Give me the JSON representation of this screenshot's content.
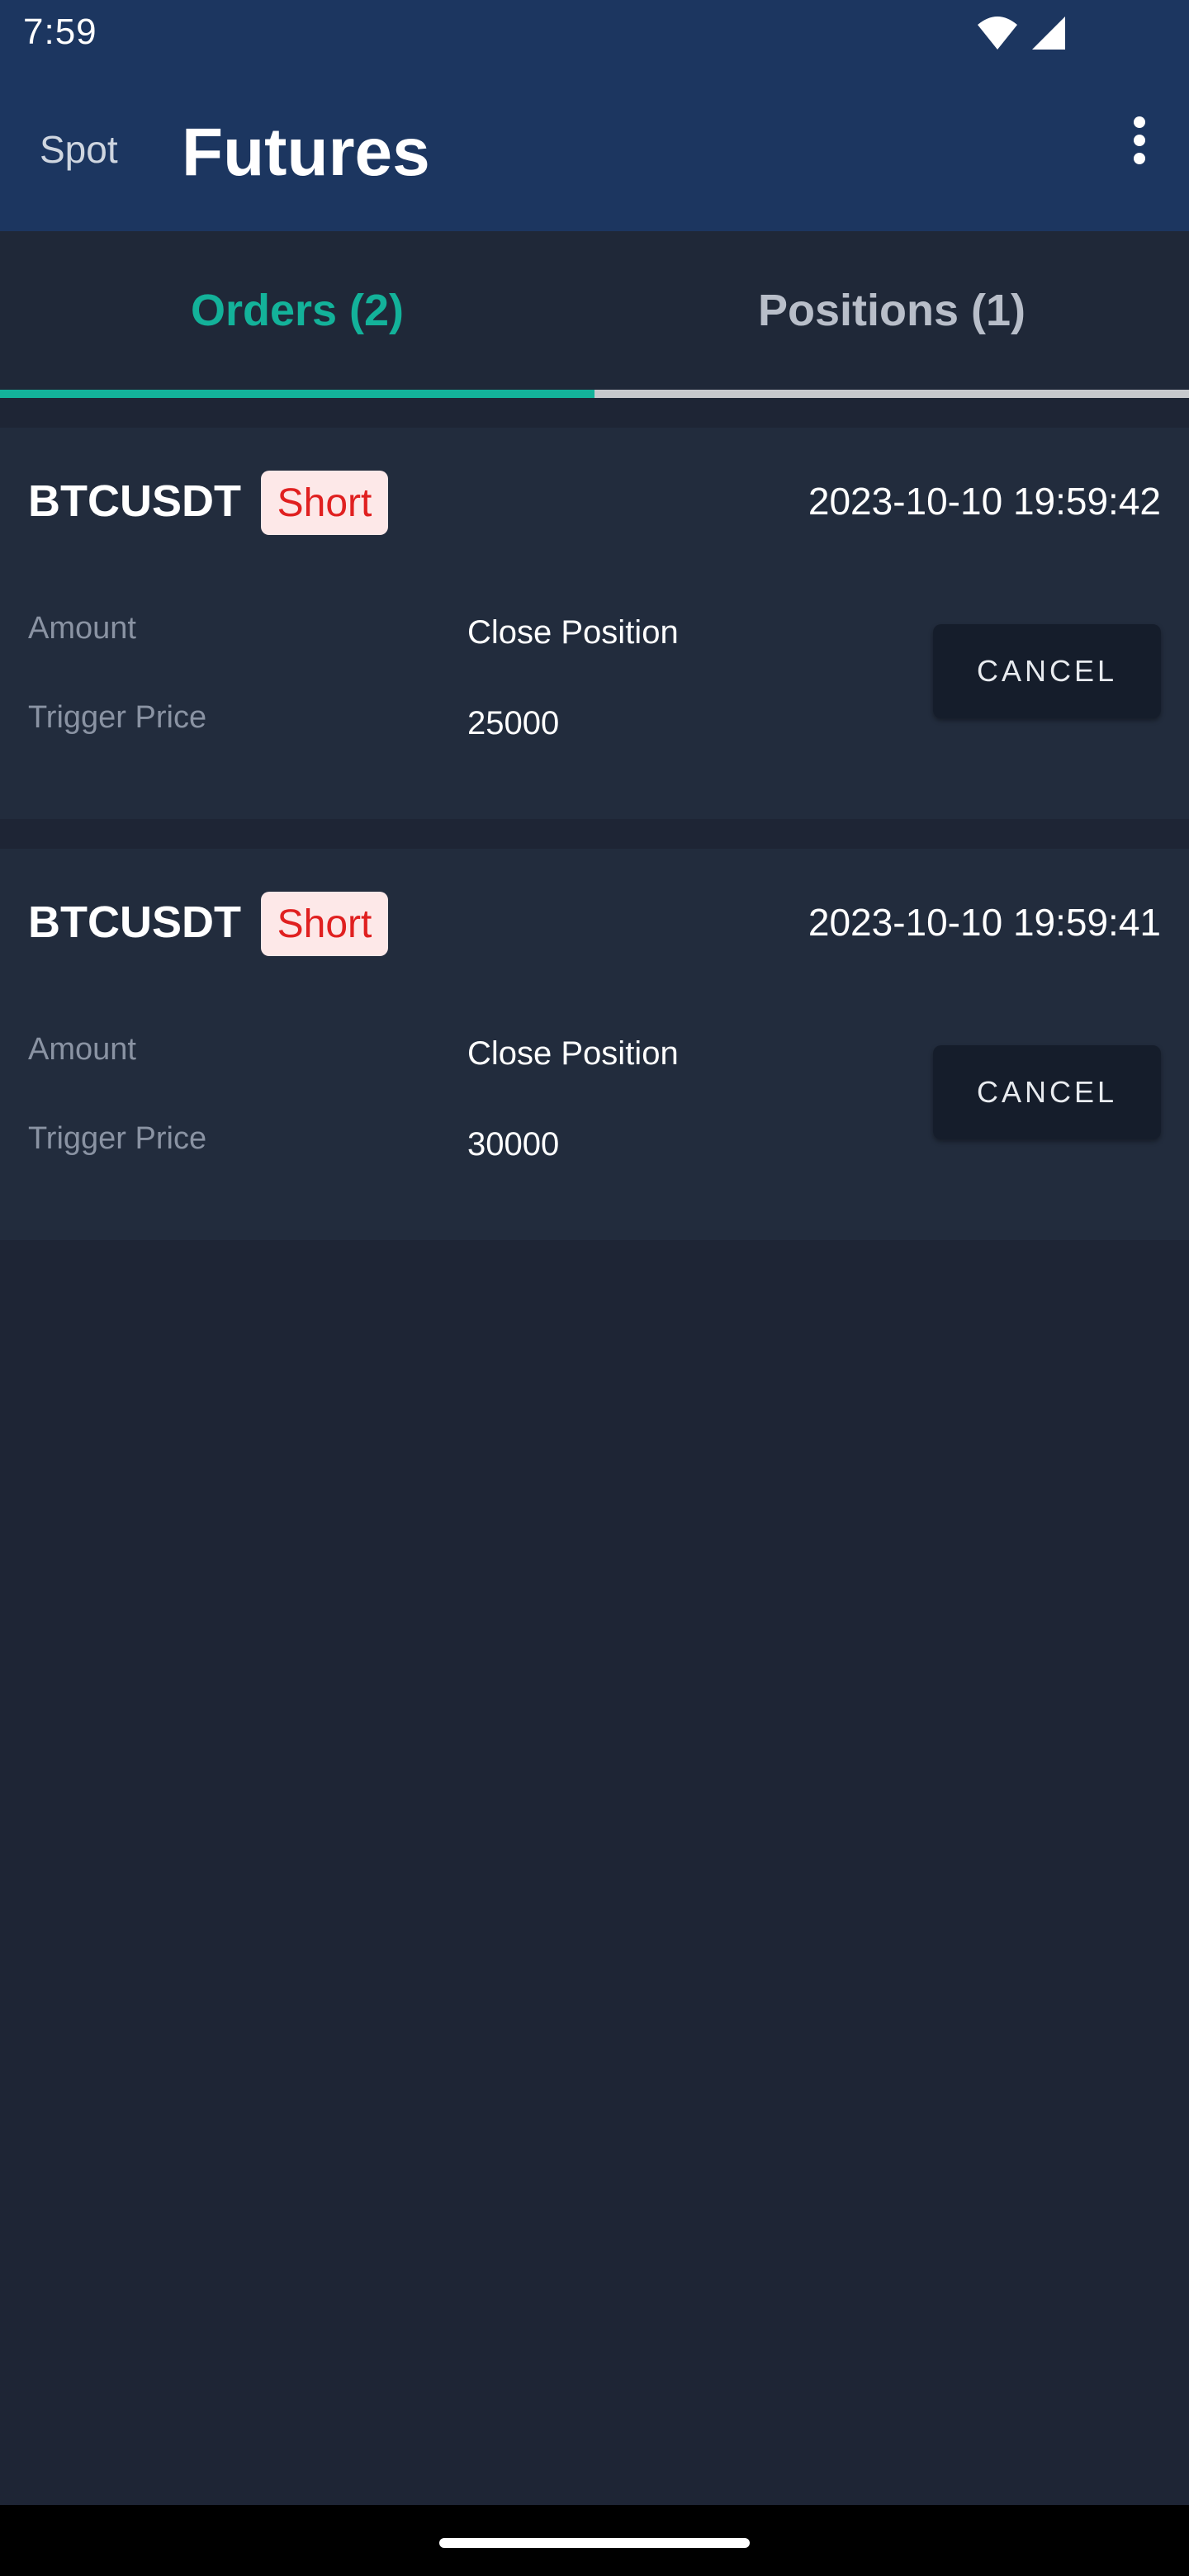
{
  "status_bar": {
    "time": "7:59",
    "icons": [
      "wifi-icon",
      "cellular-signal-icon"
    ]
  },
  "app_bar": {
    "spot_label": "Spot",
    "title": "Futures",
    "menu_icon": "more-vert-icon"
  },
  "tabs": [
    {
      "label": "Orders (2)",
      "active": true
    },
    {
      "label": "Positions (1)",
      "active": false
    }
  ],
  "orders": [
    {
      "symbol": "BTCUSDT",
      "side": "Short",
      "time": "2023-10-10 19:59:42",
      "amount_label": "Amount",
      "amount_value": "Close Position",
      "trigger_label": "Trigger Price",
      "trigger_value": "25000",
      "cancel_label": "CANCEL"
    },
    {
      "symbol": "BTCUSDT",
      "side": "Short",
      "time": "2023-10-10 19:59:41",
      "amount_label": "Amount",
      "amount_value": "Close Position",
      "trigger_label": "Trigger Price",
      "trigger_value": "30000",
      "cancel_label": "CANCEL"
    }
  ],
  "colors": {
    "header_bg": "#1c3660",
    "page_bg": "#1e2535",
    "accent": "#13b29a",
    "short_text": "#e02020",
    "short_bg": "#fde8e8"
  }
}
